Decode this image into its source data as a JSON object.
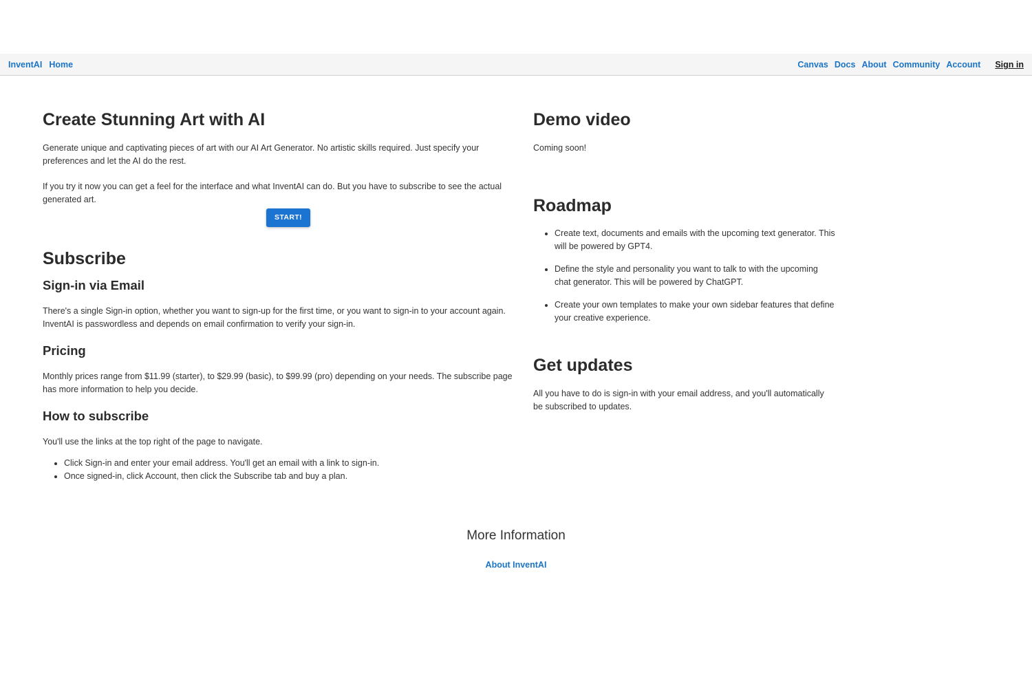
{
  "nav": {
    "brand": "InventAI",
    "home": "Home",
    "links": [
      "Canvas",
      "Docs",
      "About",
      "Community",
      "Account"
    ],
    "signin": "Sign in"
  },
  "hero": {
    "title": "Create Stunning Art with AI",
    "para1": "Generate unique and captivating pieces of art with our AI Art Generator. No artistic skills required. Just specify your preferences and let the AI do the rest.",
    "para2": "If you try it now you can get a feel for the interface and what InventAI can do. But you have to subscribe to see the actual generated art.",
    "start_label": "START!"
  },
  "subscribe": {
    "title": "Subscribe",
    "signin_heading": "Sign-in via Email",
    "signin_text": "There's a single Sign-in option, whether you want to sign-up for the first time, or you want to sign-in to your account again. InventAI is passwordless and depends on email confirmation to verify your sign-in.",
    "pricing_heading": "Pricing",
    "pricing_text": "Monthly prices range from $11.99 (starter), to $29.99 (basic), to $99.99 (pro) depending on your needs. The subscribe page has more information to help you decide.",
    "how_heading": "How to subscribe",
    "how_text": "You'll use the links at the top right of the page to navigate.",
    "steps": [
      "Click Sign-in and enter your email address. You'll get an email with a link to sign-in.",
      "Once signed-in, click Account, then click the Subscribe tab and buy a plan."
    ]
  },
  "demo": {
    "title": "Demo video",
    "text": "Coming soon!"
  },
  "roadmap": {
    "title": "Roadmap",
    "items": [
      "Create text, documents and emails with the upcoming text generator. This will be powered by GPT4.",
      "Define the style and personality you want to talk to with the upcoming chat generator. This will be powered by ChatGPT.",
      "Create your own templates to make your own sidebar features that define your creative experience."
    ]
  },
  "updates": {
    "title": "Get updates",
    "text": "All you have to do is sign-in with your email address, and you'll automatically be subscribed to updates."
  },
  "footer": {
    "title": "More Information",
    "link": "About InventAI"
  }
}
